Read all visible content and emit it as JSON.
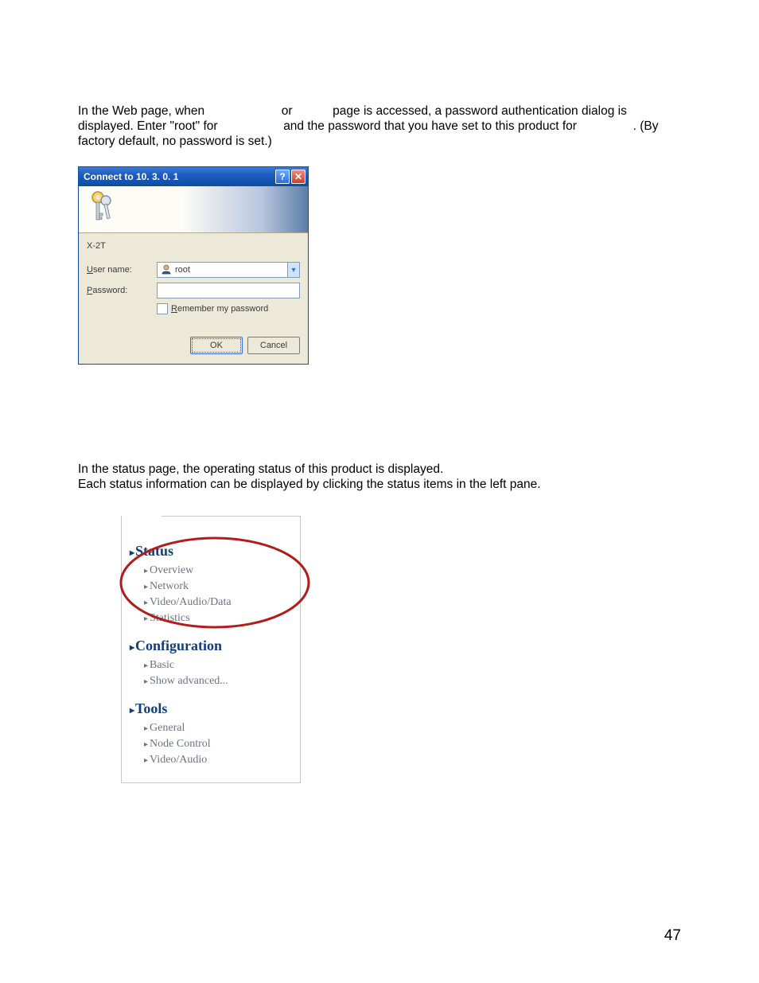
{
  "paragraph": {
    "l1_a": "In the Web page, when ",
    "l1_b": " or ",
    "l1_c": " page is accessed, a password authentication dialog is",
    "l2_a": "displayed.  Enter \"root\" for ",
    "l2_b": " and the password that you have set to this product for ",
    "l2_c": ".  (By",
    "l3": "factory default, no password is set.)"
  },
  "dialog": {
    "title": "Connect to 10. 3. 0. 1",
    "realm": "X-2T",
    "user_label": "ser name:",
    "user_u": "U",
    "user_value": "root",
    "pass_label": "assword:",
    "pass_u": "P",
    "remember_u": "R",
    "remember": "emember my password",
    "ok": "OK",
    "cancel": "Cancel"
  },
  "status_desc": {
    "l1": "In the status page, the operating status of this product is displayed.",
    "l2": "Each status information can be displayed by clicking the status items in the left pane."
  },
  "nav": {
    "status": {
      "head": "Status",
      "items": [
        "Overview",
        "Network",
        "Video/Audio/Data",
        "Statistics"
      ]
    },
    "config": {
      "head": "Configuration",
      "items": [
        "Basic",
        "Show advanced..."
      ]
    },
    "tools": {
      "head": "Tools",
      "items": [
        "General",
        "Node Control",
        "Video/Audio"
      ]
    }
  },
  "page_number": "47"
}
